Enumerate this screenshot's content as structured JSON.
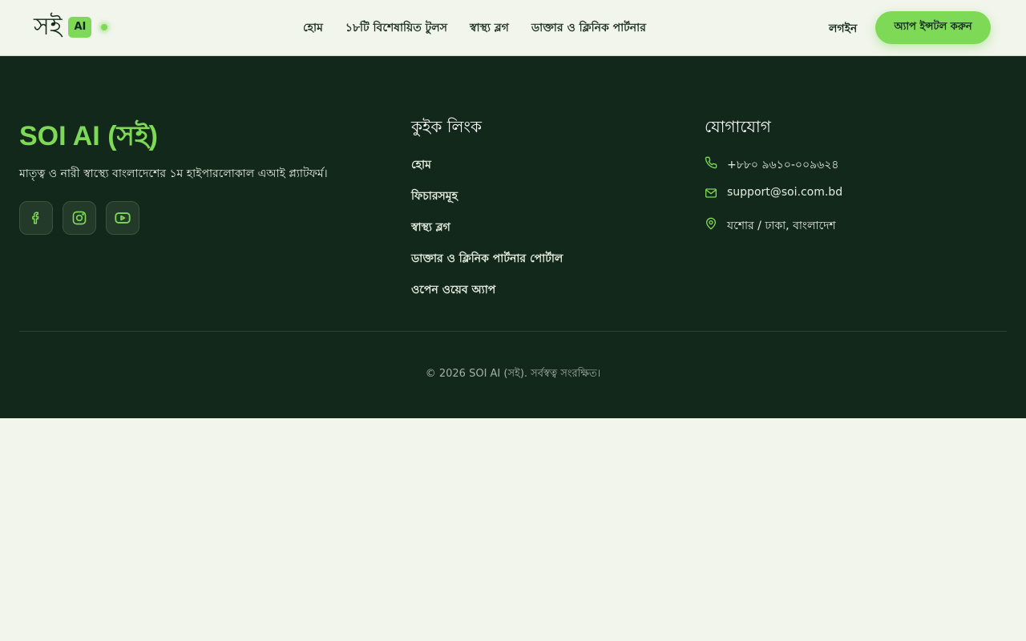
{
  "navbar": {
    "logo_text": "সই",
    "logo_badge": "AI",
    "links": [
      {
        "label": "হোম"
      },
      {
        "label": "১৮টি বিশেষায়িত টুলস"
      },
      {
        "label": "স্বাস্থ্য ব্লগ"
      },
      {
        "label": "ডাক্তার ও ক্লিনিক পার্টনার"
      }
    ],
    "login_label": "লগইন",
    "install_label": "অ্যাপ ইন্সটল করুন"
  },
  "footer": {
    "brand_title": "SOI AI (সই)",
    "brand_desc": "মাতৃত্ব ও নারী স্বাস্থ্যে বাংলাদেশের ১ম হাইপারলোকাল এআই প্ল্যাটফর্ম।",
    "socials": [
      {
        "icon": "facebook-icon"
      },
      {
        "icon": "instagram-icon"
      },
      {
        "icon": "youtube-icon"
      }
    ],
    "quick_links_title": "কুইক লিংক",
    "quick_links": [
      {
        "label": "হোম"
      },
      {
        "label": "ফিচারসমূহ"
      },
      {
        "label": "স্বাস্থ্য ব্লগ"
      },
      {
        "label": "ডাক্তার ও ক্লিনিক পার্টনার পোর্টাল"
      },
      {
        "label": "ওপেন ওয়েব অ্যাপ"
      }
    ],
    "contact_title": "যোগাযোগ",
    "contacts": [
      {
        "icon": "phone-icon",
        "text": "+৮৮০ ৯৬১০-০০৯৬২৪"
      },
      {
        "icon": "mail-icon",
        "text": "support@soi.com.bd"
      },
      {
        "icon": "location-pin-icon",
        "text": "যশোর / ঢাকা, বাংলাদেশ"
      }
    ],
    "copyright": "© 2026 SOI AI (সই). সর্বস্বত্ব সংরক্ষিত।"
  },
  "colors": {
    "accent": "#7ed957",
    "footer_bg": "#12281a",
    "page_bg": "#f1f5ec"
  }
}
